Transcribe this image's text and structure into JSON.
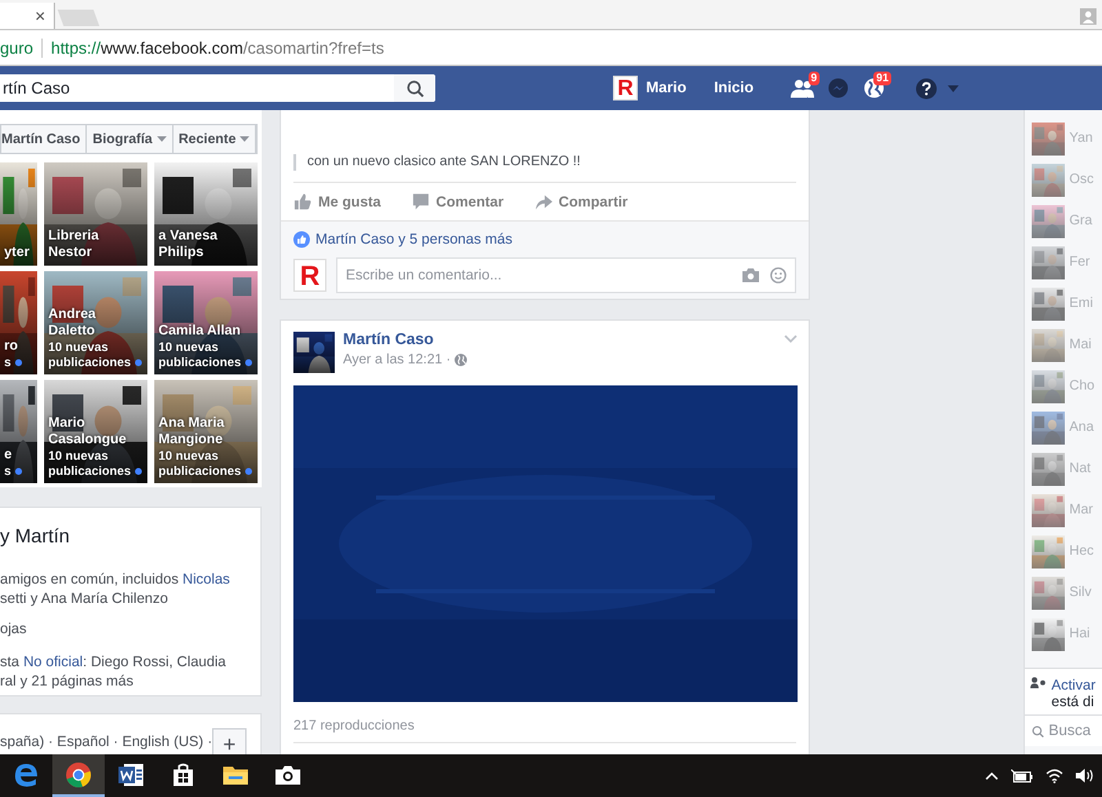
{
  "browser": {
    "tab_close": "×",
    "security_label": "guro",
    "url_scheme": "https://",
    "url_host": "www.facebook.com",
    "url_path": "/casomartin?fref=ts"
  },
  "topbar": {
    "search_value": "rtín Caso",
    "avatar_text": "R",
    "profile_name": "Mario",
    "home_link": "Inicio",
    "notifications": [
      {
        "kind": "friends",
        "badge": "9"
      },
      {
        "kind": "messages"
      },
      {
        "kind": "globe",
        "badge": "91"
      }
    ]
  },
  "profile_nav": [
    {
      "label": "Martín Caso",
      "dropdown": false
    },
    {
      "label": "Biografía",
      "dropdown": true
    },
    {
      "label": "Reciente",
      "dropdown": true
    }
  ],
  "tiles": [
    {
      "name": "yter",
      "unread": false
    },
    {
      "name": "Libreria Nestor",
      "unread": false
    },
    {
      "name": "a Vanesa Philips",
      "unread": false
    },
    {
      "name": "ro",
      "updates": "s",
      "unread": true
    },
    {
      "name": "Andrea Daletto",
      "updates": "10 nuevas publicaciones",
      "unread": true
    },
    {
      "name": "Camila Allan",
      "updates": "10 nuevas publicaciones",
      "unread": true
    },
    {
      "name": "e",
      "updates": "s",
      "unread": true
    },
    {
      "name": "Mario Casalongue",
      "updates": "10 nuevas publicaciones",
      "unread": true
    },
    {
      "name": "Ana Maria Mangione",
      "updates": "10 nuevas publicaciones",
      "unread": true
    }
  ],
  "about": {
    "heading": "y Martín",
    "paragraphs": [
      [
        [
          {
            "text": "amigos en común, incluidos ",
            "link": false
          },
          {
            "text": "Nicolas",
            "link": true
          }
        ],
        [
          {
            "text": "setti y Ana María Chilenzo",
            "link": false
          }
        ]
      ],
      [
        [
          {
            "text": "ojas",
            "link": false
          }
        ]
      ],
      [
        [
          {
            "text": "sta ",
            "link": false
          },
          {
            "text": "No oficial",
            "link": true
          },
          {
            "text": ": Diego Rossi, Claudia",
            "link": false
          }
        ],
        [
          {
            "text": "ral y 21 páginas más",
            "link": false
          }
        ]
      ]
    ]
  },
  "languages": {
    "line": "spaña) · Español · English (US) ·",
    "add_button": "+"
  },
  "feed": [
    {
      "kind": "shared",
      "quote": "con un nuevo clasico ante SAN LORENZO !!",
      "actions": [
        {
          "kind": "like",
          "label": "Me gusta"
        },
        {
          "kind": "comment",
          "label": "Comentar"
        },
        {
          "kind": "share",
          "label": "Compartir"
        }
      ],
      "likes": "Martín Caso y 5 personas más",
      "comment_avatar_text": "R",
      "comment_placeholder": "Escribe un comentario..."
    },
    {
      "kind": "video",
      "author": "Martín Caso",
      "time": "Ayer a las 12:21 ·",
      "views": "217 reproducciones"
    }
  ],
  "chat": {
    "contacts": [
      {
        "name": "Yan"
      },
      {
        "name": "Osc"
      },
      {
        "name": "Gra"
      },
      {
        "name": "Fer"
      },
      {
        "name": "Emi"
      },
      {
        "name": "Mai"
      },
      {
        "name": "Cho"
      },
      {
        "name": "Ana"
      },
      {
        "name": "Nat"
      },
      {
        "name": "Mar"
      },
      {
        "name": "Hec"
      },
      {
        "name": "Silv"
      },
      {
        "name": "Hai"
      }
    ],
    "turn_on_link": "Activar",
    "turn_on_text": "está di",
    "search_placeholder": "Busca"
  },
  "taskbar": {
    "apps": [
      {
        "kind": "edge",
        "selected": false
      },
      {
        "kind": "chrome",
        "selected": true
      },
      {
        "kind": "word",
        "selected": false
      },
      {
        "kind": "store",
        "selected": false
      },
      {
        "kind": "explorer",
        "selected": false
      },
      {
        "kind": "camera",
        "selected": false
      }
    ]
  }
}
